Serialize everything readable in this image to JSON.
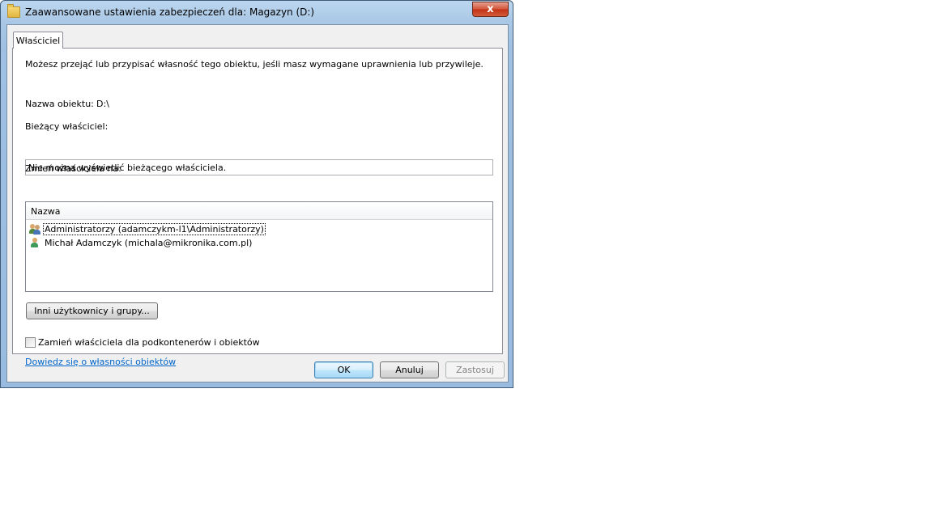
{
  "window": {
    "title": "Zaawansowane ustawienia zabezpieczeń dla: Magazyn (D:)",
    "close_glyph": "x",
    "folder_icon": "folder-icon"
  },
  "tab": {
    "label": "Właściciel"
  },
  "panel": {
    "description": "Możesz przejąć lub przypisać własność tego obiektu, jeśli masz wymagane uprawnienia lub przywileje.",
    "object_name_label": "Nazwa obiektu:",
    "object_name_value": "D:\\",
    "current_owner_label": "Bieżący właściciel:",
    "current_owner_value": "Nie można wyświetlić bieżącego właściciela.",
    "change_owner_label": "Zmień właściciela na:",
    "list_header": "Nazwa",
    "owners": [
      {
        "label": "Administratorzy (adamczykm-l1\\Administratorzy)",
        "icon": "users-group-icon"
      },
      {
        "label": "Michał Adamczyk (michala@mikronika.com.pl)",
        "icon": "user-icon"
      }
    ],
    "other_users_button": "Inni użytkownicy i grupy...",
    "replace_checkbox_label": "Zamień właściciela dla podkontenerów i obiektów",
    "replace_checkbox_checked": false,
    "learn_link": "Dowiedz się o własności obiektów"
  },
  "buttons": {
    "ok": "OK",
    "cancel": "Anuluj",
    "apply": "Zastosuj"
  },
  "colors": {
    "link": "#0066cc",
    "close": "#c23217",
    "frame": "#a9c8e6"
  }
}
